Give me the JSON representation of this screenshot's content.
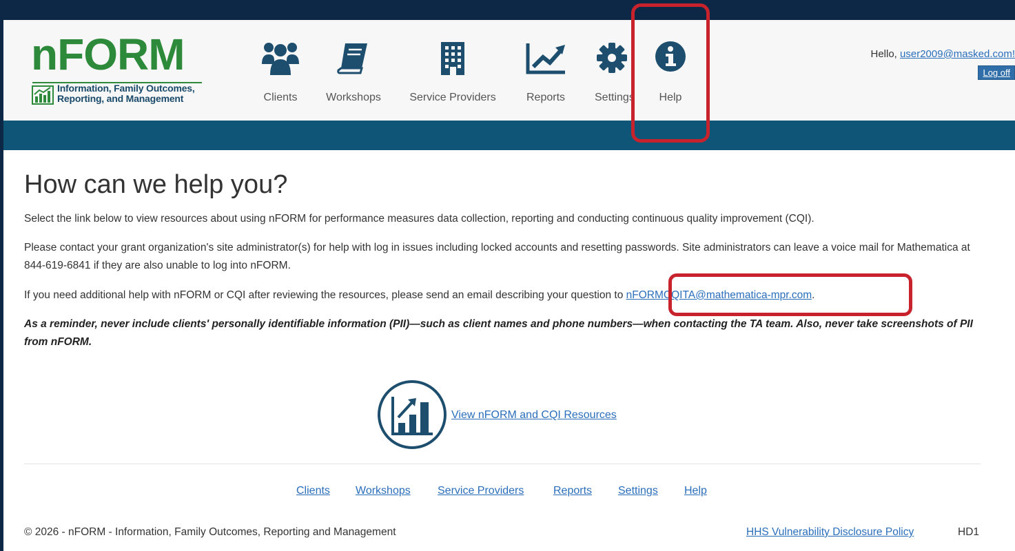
{
  "logo": {
    "word": "nFORM",
    "tagline_line1": "Information, Family Outcomes,",
    "tagline_line2": "Reporting, and Management"
  },
  "nav": [
    {
      "label": "Clients",
      "icon": "users-icon"
    },
    {
      "label": "Workshops",
      "icon": "book-icon"
    },
    {
      "label": "Service Providers",
      "icon": "building-icon"
    },
    {
      "label": "Reports",
      "icon": "line-chart-icon"
    },
    {
      "label": "Settings",
      "icon": "gear-icon"
    },
    {
      "label": "Help",
      "icon": "info-circle-icon"
    }
  ],
  "user": {
    "greeting": "Hello, ",
    "email": "user2009@masked.com!",
    "logoff": "Log off"
  },
  "main": {
    "title": "How can we help you?",
    "p1": "Select the link below to view resources about using nFORM for performance measures data collection, reporting and conducting continuous quality improvement (CQI).",
    "p2": "Please contact your grant organization's site administrator(s) for help with log in issues including locked accounts and resetting passwords. Site administrators can leave a voice mail for Mathematica at 844-619-6841 if they are also unable to log into nFORM.",
    "p3_prefix": "If you need additional help with nFORM or CQI after reviewing the resources, please send an email describing your question to ",
    "p3_email": "nFORMCQITA@mathematica-mpr.com",
    "p3_suffix": ".",
    "warning": "As a reminder, never include clients' personally identifiable information (PII)—such as client names and phone numbers—when contacting the TA team. Also, never take screenshots of PII from nFORM.",
    "resources_link": "View nFORM and CQI Resources"
  },
  "footer": {
    "links": [
      "Clients",
      "Workshops",
      "Service Providers",
      "Reports",
      "Settings",
      "Help"
    ],
    "copyright": "© 2026 - nFORM - Information, Family Outcomes, Reporting and Management",
    "policy": "HHS Vulnerability Disclosure Policy",
    "server": "HD1"
  },
  "colors": {
    "frame": "#0c2846",
    "band": "#0f5577",
    "logo_green": "#2d8a3a",
    "nav_icon": "#1d4e6e",
    "highlight": "#c8232c",
    "link": "#2a6ebb"
  }
}
